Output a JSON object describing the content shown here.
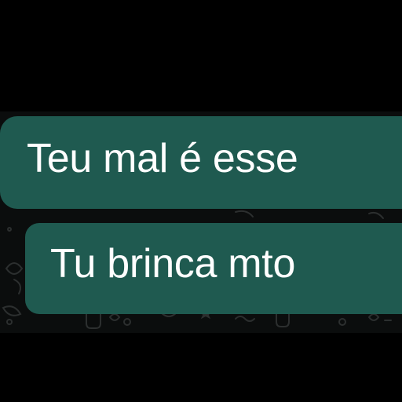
{
  "chat": {
    "messages": [
      {
        "text": "Teu mal é esse"
      },
      {
        "text": "Tu brinca mto"
      }
    ]
  },
  "colors": {
    "bubble": "#1f5a50",
    "text": "#ffffff",
    "background": "#000000",
    "wallpaper": "#0b0d0d",
    "doodle": "#2c2f2f"
  }
}
